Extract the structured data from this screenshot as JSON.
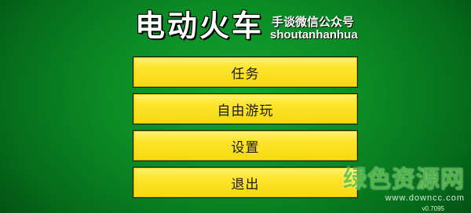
{
  "header": {
    "title": "电动火车",
    "wechat_label": "手谈微信公众号",
    "wechat_id": "shoutanhanhua"
  },
  "menu": {
    "items": [
      {
        "label": "任务"
      },
      {
        "label": "自由游玩"
      },
      {
        "label": "设置"
      },
      {
        "label": "退出"
      }
    ]
  },
  "footer": {
    "version": "v0.7095"
  },
  "watermark": {
    "brand": "绿色资源网",
    "url": "www.downcc.com"
  },
  "colors": {
    "background": "#0b8a25",
    "button_fill": "#fde52d",
    "title_text": "#ffffff"
  }
}
